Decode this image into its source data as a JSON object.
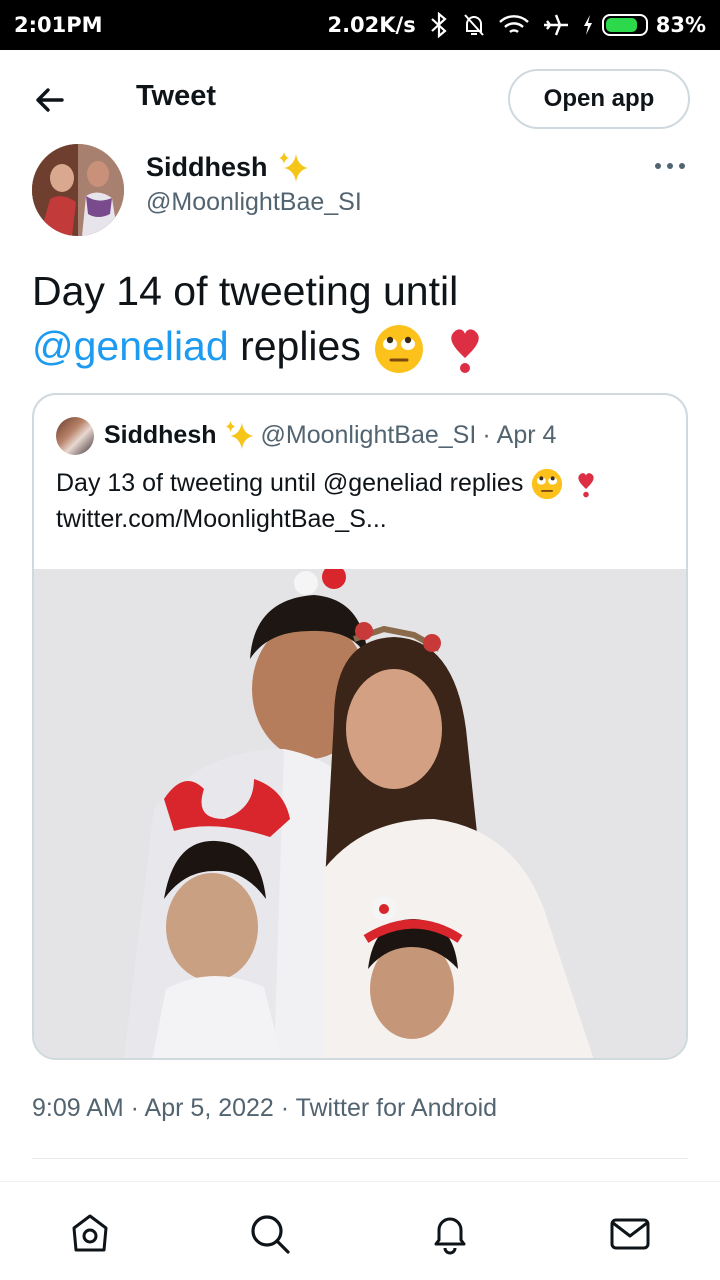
{
  "status_bar": {
    "time": "2:01PM",
    "speed": "2.02K/s",
    "battery": "83%",
    "battery_level": 0.83
  },
  "header": {
    "title": "Tweet",
    "open_app_label": "Open app"
  },
  "tweet": {
    "author_name": "Siddhesh",
    "author_handle": "@MoonlightBae_SI",
    "text_line1": "Day 14 of tweeting until",
    "mention": "@geneliad",
    "text_after_mention": "replies",
    "timestamp": "9:09 AM · Apr 5, 2022 · Twitter for Android"
  },
  "quoted_tweet": {
    "author_name": "Siddhesh",
    "author_handle": "@MoonlightBae_SI",
    "separator": "·",
    "date": "Apr 4",
    "text": "Day 13 of tweeting until @geneliad replies",
    "link": "twitter.com/MoonlightBae_S..."
  },
  "icons": {
    "back": "arrow-left-icon",
    "more": "more-horizontal-icon",
    "sparkle": "sparkles-icon",
    "home": "home-icon",
    "search": "search-icon",
    "notifications": "bell-icon",
    "messages": "mail-icon"
  },
  "colors": {
    "accent": "#1d9bf0",
    "secondary_text": "#536471",
    "border": "#cfd9de",
    "heart": "#e0245e",
    "sparkle": "#f5c518"
  }
}
